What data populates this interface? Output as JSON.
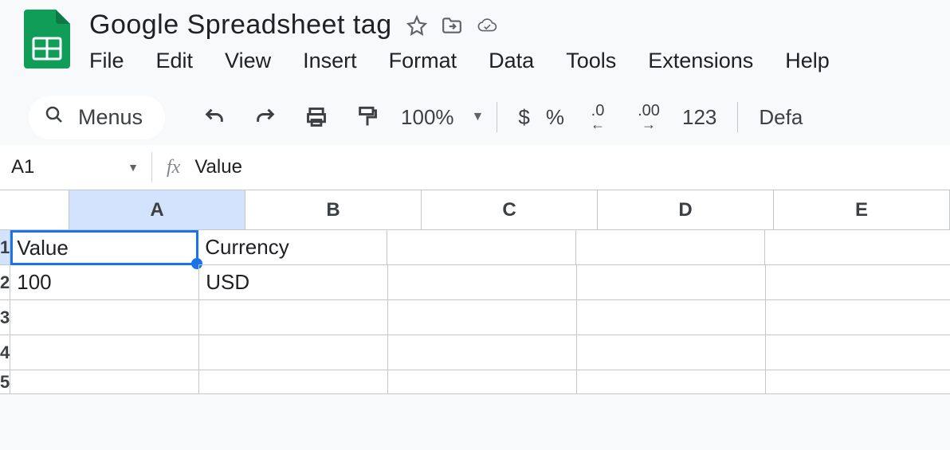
{
  "app": {
    "title": "Google Spreadsheet tag"
  },
  "menubar": {
    "file": "File",
    "edit": "Edit",
    "view": "View",
    "insert": "Insert",
    "format": "Format",
    "data": "Data",
    "tools": "Tools",
    "ext": "Extensions",
    "help": "Help"
  },
  "toolbar": {
    "menus_label": "Menus",
    "zoom": "100%",
    "currency": "$",
    "percent": "%",
    "dec_less": ".0",
    "dec_more": ".00",
    "num_fmt": "123",
    "font_label": "Defa"
  },
  "name_box": "A1",
  "formula_value": "Value",
  "columns": [
    "A",
    "B",
    "C",
    "D",
    "E"
  ],
  "rows": [
    "1",
    "2",
    "3",
    "4",
    "5"
  ],
  "selected": {
    "col": 0,
    "row": 0
  },
  "cells": {
    "A1": "Value",
    "B1": "Currency",
    "A2": "100",
    "B2": "USD"
  }
}
